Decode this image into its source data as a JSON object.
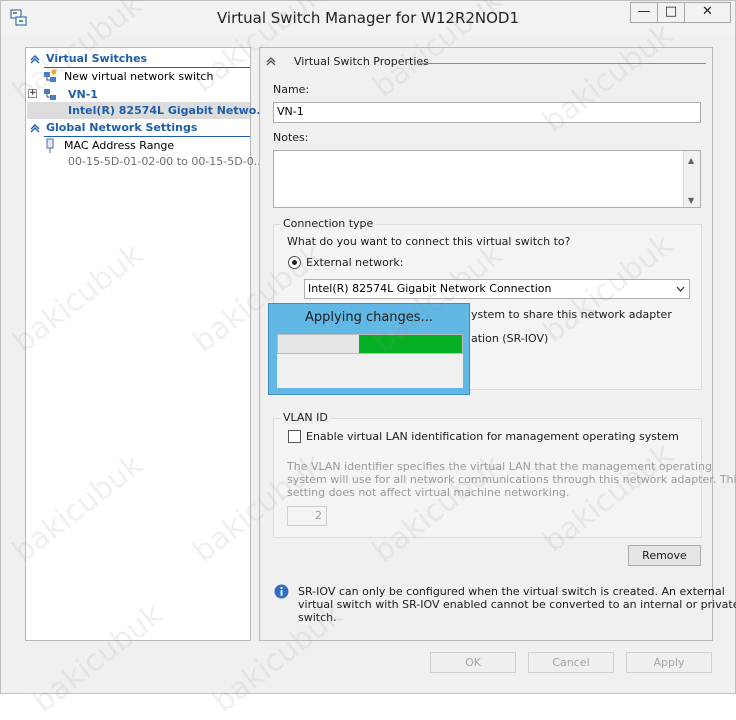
{
  "window": {
    "title": "Virtual Switch Manager for W12R2NOD1",
    "controls": {
      "minimize": "—",
      "maximize": "□",
      "close": "✕"
    }
  },
  "sidebar": {
    "virtual_switches_header": "Virtual Switches",
    "new_switch": "New virtual network switch",
    "switch_name": "VN-1",
    "switch_adapter": "Intel(R) 82574L Gigabit Netwo...",
    "global_header": "Global Network Settings",
    "mac_range_label": "MAC Address Range",
    "mac_range_value": "00-15-5D-01-02-00 to 00-15-5D-0..."
  },
  "properties": {
    "section_title": "Virtual Switch Properties",
    "name_label": "Name:",
    "name_value": "VN-1",
    "notes_label": "Notes:",
    "notes_value": "",
    "connection_type_label": "Connection type",
    "connection_question": "What do you want to connect this virtual switch to?",
    "external_label": "External network:",
    "adapter_selected": "Intel(R) 82574L Gigabit Network Connection",
    "share_adapter_partial": "ystem to share this network adapter",
    "sriov_partial": "ation (SR-IOV)",
    "vlan_group_label": "VLAN ID",
    "vlan_checkbox_label": "Enable virtual LAN identification for management operating system",
    "vlan_desc_1": "The VLAN identifier specifies the virtual LAN that the management operating",
    "vlan_desc_2": "system will use for all network communications through this network adapter. This",
    "vlan_desc_3": "setting does not affect virtual machine networking.",
    "vlan_value": "2",
    "remove_button": "Remove",
    "info_1": "SR-IOV can only be configured when the virtual switch is created. An external",
    "info_2": "virtual switch with SR-IOV enabled cannot be converted to an internal or private",
    "info_3": "switch."
  },
  "dialog": {
    "title": "Applying changes...",
    "progress_segment": [
      0.44,
      1.0
    ]
  },
  "buttons": {
    "ok": "OK",
    "cancel": "Cancel",
    "apply": "Apply"
  },
  "watermark": "bakicubuk",
  "colors": {
    "section_blue": "#1f5fa8",
    "dialog_blue": "#61b8e4",
    "progress_green": "#06b025"
  }
}
